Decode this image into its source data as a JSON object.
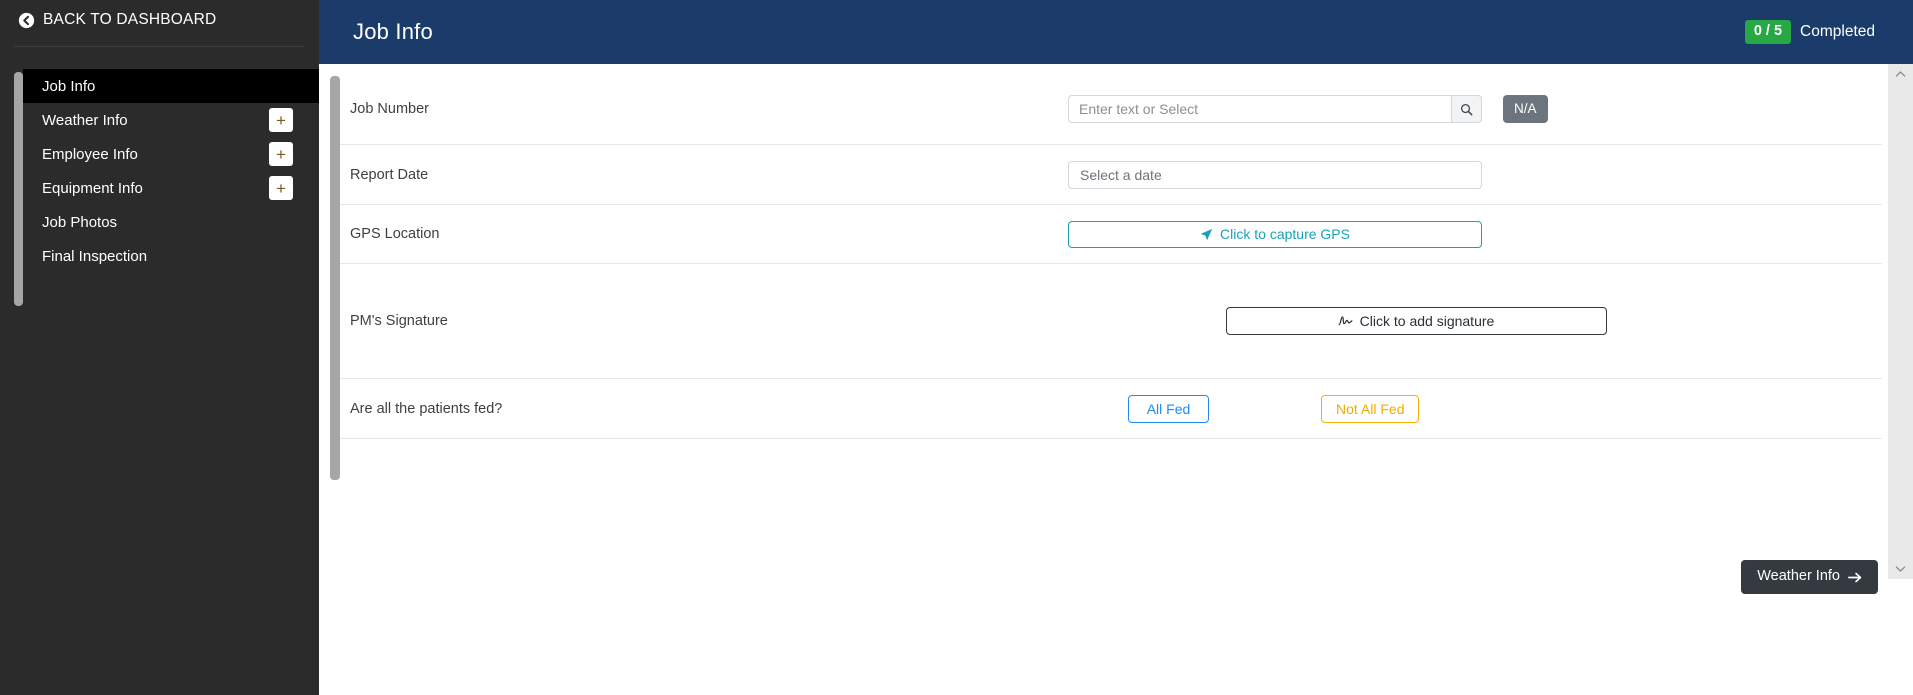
{
  "sidebar": {
    "back_label": "BACK TO DASHBOARD",
    "back_icon": "arrow-circle-left-icon",
    "items": [
      {
        "label": "Job Info",
        "active": true,
        "has_add": false,
        "add_label": ""
      },
      {
        "label": "Weather Info",
        "active": false,
        "has_add": true,
        "add_label": "+"
      },
      {
        "label": "Employee Info",
        "active": false,
        "has_add": true,
        "add_label": "+"
      },
      {
        "label": "Equipment Info",
        "active": false,
        "has_add": true,
        "add_label": "+"
      },
      {
        "label": "Job Photos",
        "active": false,
        "has_add": false,
        "add_label": ""
      },
      {
        "label": "Final Inspection",
        "active": false,
        "has_add": false,
        "add_label": ""
      }
    ]
  },
  "header": {
    "title": "Job Info",
    "progress_count": "0 / 5",
    "progress_label": "Completed",
    "bg_color": "#1b3c6b",
    "badge_color": "#28a745"
  },
  "form": {
    "rows": [
      {
        "label": "Job Number"
      },
      {
        "label": "Report Date"
      },
      {
        "label": "GPS Location"
      },
      {
        "label": "PM's Signature"
      },
      {
        "label": "Are all the patients fed?"
      }
    ]
  },
  "job_number": {
    "value": "",
    "placeholder": "Enter text or Select",
    "search_icon": "search-icon",
    "na_label": "N/A"
  },
  "report_date": {
    "value": "",
    "placeholder": "Select a date"
  },
  "gps": {
    "button_label": "Click to capture GPS",
    "icon": "location-arrow-icon",
    "color": "#17a2b8"
  },
  "signature": {
    "button_label": "Click to add signature",
    "icon": "signature-icon"
  },
  "fed_question": {
    "yes_label": "All Fed",
    "no_label": "Not All Fed",
    "yes_color": "#1d8bf1",
    "no_color": "#f0ad00"
  },
  "footer": {
    "next_label": "Weather Info",
    "next_icon": "arrow-right-icon"
  },
  "scrollbar": {
    "up_icon": "chevron-up-icon",
    "down_icon": "chevron-down-icon"
  }
}
